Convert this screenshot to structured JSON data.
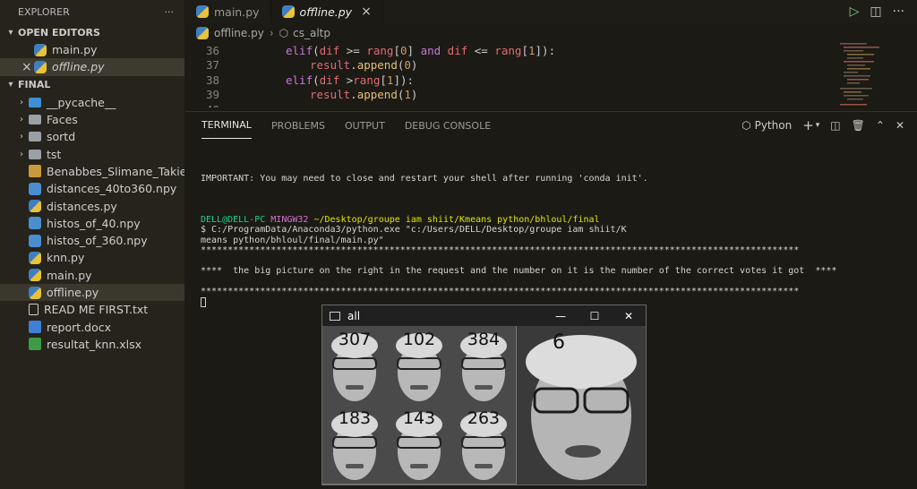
{
  "sidebar": {
    "title": "EXPLORER",
    "more": "···",
    "open_editors": {
      "label": "OPEN EDITORS",
      "items": [
        {
          "name": "main.py"
        },
        {
          "name": "offline.py",
          "close": "×"
        }
      ]
    },
    "folder": {
      "label": "FINAL",
      "items": [
        {
          "name": "__pycache__",
          "kind": "folder-special"
        },
        {
          "name": "Faces",
          "kind": "folder"
        },
        {
          "name": "sortd",
          "kind": "folder"
        },
        {
          "name": "tst",
          "kind": "folder"
        },
        {
          "name": "Benabbes_Slimane_Takiedine...",
          "kind": "image"
        },
        {
          "name": "distances_40to360.npy",
          "kind": "npy"
        },
        {
          "name": "distances.py",
          "kind": "py"
        },
        {
          "name": "histos_of_40.npy",
          "kind": "npy"
        },
        {
          "name": "histos_of_360.npy",
          "kind": "npy"
        },
        {
          "name": "knn.py",
          "kind": "py"
        },
        {
          "name": "main.py",
          "kind": "py"
        },
        {
          "name": "offline.py",
          "kind": "py"
        },
        {
          "name": "READ ME FIRST.txt",
          "kind": "txt"
        },
        {
          "name": "report.docx",
          "kind": "docx"
        },
        {
          "name": "resultat_knn.xlsx",
          "kind": "xlsx"
        }
      ]
    }
  },
  "tabs": [
    {
      "label": "main.py"
    },
    {
      "label": "offline.py",
      "close": "×"
    }
  ],
  "breadcrumb": [
    "offline.py",
    "cs_altp"
  ],
  "code": [
    {
      "line": "36",
      "text": "elif(dif >= rang[0] and dif <= rang[1]):"
    },
    {
      "line": "37",
      "text": "result.append(0)"
    },
    {
      "line": "38",
      "text": "elif(dif >rang[1]):"
    },
    {
      "line": "39",
      "text": "result.append(1)"
    },
    {
      "line": "40",
      "text": ""
    }
  ],
  "panel": {
    "tabs": [
      "TERMINAL",
      "PROBLEMS",
      "OUTPUT",
      "DEBUG CONSOLE"
    ],
    "shell": "Python",
    "terminal": {
      "important": "IMPORTANT: You may need to close and restart your shell after running 'conda init'.",
      "prompt_user": "DELL@DELL-PC",
      "prompt_shell": "MINGW32",
      "prompt_path": "~/Desktop/groupe iam shiit/Kmeans python/bhloul/final",
      "command_1": "$ C:/ProgramData/Anaconda3/python.exe \"c:/Users/DELL/Desktop/groupe iam shiit/K",
      "command_2": "means python/bhloul/final/main.py\"",
      "stars": "***************************************************************************************************************",
      "message": "****  the big picture on the right in the request and the number on it is the number of the correct votes it got  ****"
    }
  },
  "window": {
    "title": "all",
    "minimize": "—",
    "maximize": "☐",
    "close": "✕",
    "thumb_labels": [
      "307",
      "102",
      "384",
      "183",
      "143",
      "263"
    ],
    "big_label": "6"
  }
}
